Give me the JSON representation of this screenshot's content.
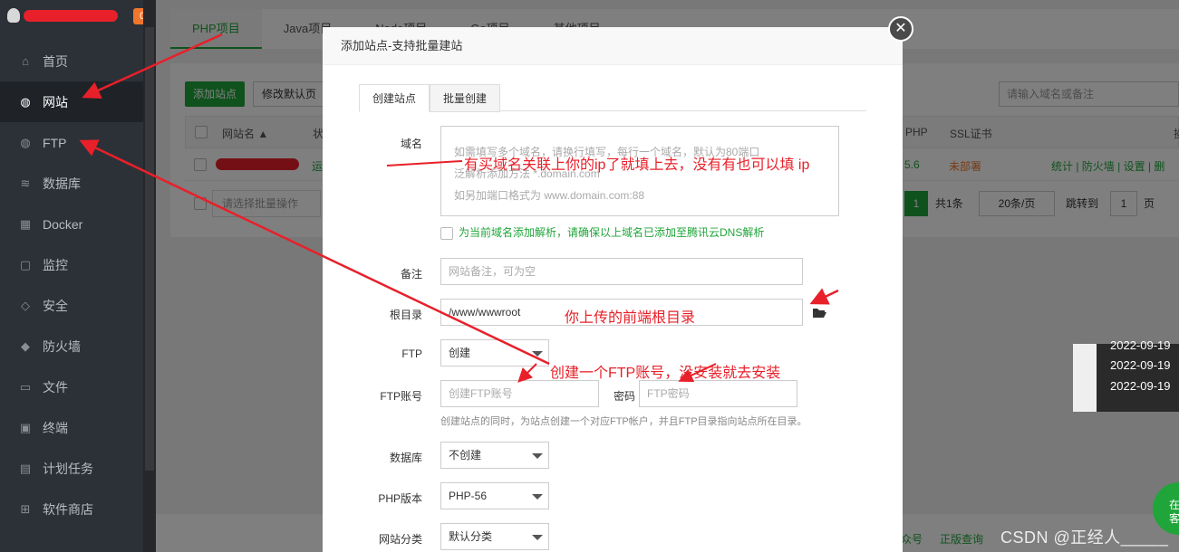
{
  "sidebar": {
    "badge": "0",
    "items": [
      {
        "label": "首页",
        "icon": "home-icon",
        "glyph": "⌂"
      },
      {
        "label": "网站",
        "icon": "globe-icon",
        "glyph": "◍"
      },
      {
        "label": "FTP",
        "icon": "ftp-icon",
        "glyph": "◍"
      },
      {
        "label": "数据库",
        "icon": "database-icon",
        "glyph": "≋"
      },
      {
        "label": "Docker",
        "icon": "docker-icon",
        "glyph": "▦"
      },
      {
        "label": "监控",
        "icon": "monitor-icon",
        "glyph": "▢"
      },
      {
        "label": "安全",
        "icon": "shield-icon",
        "glyph": "◇"
      },
      {
        "label": "防火墙",
        "icon": "firewall-icon",
        "glyph": "◆"
      },
      {
        "label": "文件",
        "icon": "folder-icon",
        "glyph": "▭"
      },
      {
        "label": "终端",
        "icon": "terminal-icon",
        "glyph": "▣"
      },
      {
        "label": "计划任务",
        "icon": "calendar-icon",
        "glyph": "▤"
      },
      {
        "label": "软件商店",
        "icon": "apps-icon",
        "glyph": "⊞"
      }
    ]
  },
  "main": {
    "tabs": [
      "PHP项目",
      "Java项目",
      "Node项目",
      "Go项目",
      "其他项目"
    ],
    "add_site": "添加站点",
    "edit_default_page": "修改默认页",
    "search_placeholder": "请输入域名或备注",
    "columns": {
      "name": "网站名 ▲",
      "status": "状",
      "php": "PHP",
      "ssl": "SSL证书",
      "action": "操"
    },
    "row": {
      "status": "运",
      "php": "5.6",
      "ssl": "未部署",
      "actions": "统计 | 防火墙 | 设置 | 删"
    },
    "batch_placeholder": "请选择批量操作",
    "pager": {
      "page": "1",
      "total": "共1条",
      "per_page": "20条/页",
      "goto": "跳转到",
      "goto_page": "1",
      "page_unit": "页"
    }
  },
  "side_popup": {
    "dates": [
      "2022-09-19",
      "2022-09-19",
      "2022-09-19"
    ]
  },
  "footer": {
    "links": [
      "众号",
      "正版查询"
    ]
  },
  "online": {
    "line1": "在",
    "line2": "客"
  },
  "watermark": "CSDN @正经人_____",
  "modal": {
    "title": "添加站点-支持批量建站",
    "tabs": [
      "创建站点",
      "批量创建"
    ],
    "domain_label": "域名",
    "domain_placeholder": [
      "如需填写多个域名，请换行填写，每行一个域名，默认为80端口",
      "泛解析添加方法 *.domain.com",
      "如另加端口格式为 www.domain.com:88"
    ],
    "dns_text": "为当前域名添加解析，请确保以上域名已添加至腾讯云DNS解析",
    "remark_label": "备注",
    "remark_placeholder": "网站备注，可为空",
    "root_label": "根目录",
    "root_value": "/www/wwwroot",
    "ftp_label": "FTP",
    "ftp_value": "创建",
    "ftp_account_label": "FTP账号",
    "ftp_account_placeholder": "创建FTP账号",
    "password_label": "密码",
    "password_placeholder": "FTP密码",
    "ftp_hint": "创建站点的同时，为站点创建一个对应FTP帐户，并且FTP目录指向站点所在目录。",
    "db_label": "数据库",
    "db_value": "不创建",
    "php_label": "PHP版本",
    "php_value": "PHP-56",
    "category_label": "网站分类",
    "category_value": "默认分类"
  },
  "annotations": {
    "domain_note": "有买域名关联上你的ip了就填上去，没有有也可以填 ip",
    "root_note": "你上传的前端根目录",
    "ftp_note": "创建一个FTP账号，没安装就去安装"
  },
  "colors": {
    "accent": "#20a53a",
    "annotation": "#e8202a",
    "sidebar": "#2c3138"
  }
}
